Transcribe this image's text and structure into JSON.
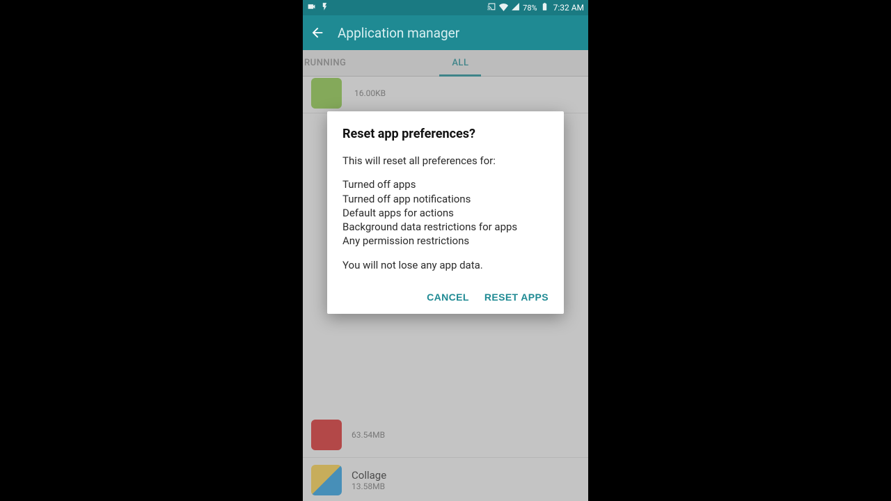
{
  "status": {
    "battery_pct": "78%",
    "time": "7:32 AM"
  },
  "appbar": {
    "title": "Application manager"
  },
  "tabs": {
    "running": "RUNNING",
    "all": "ALL"
  },
  "top_row": {
    "size": "16.00KB"
  },
  "apps": [
    {
      "name": "",
      "size": "63.54MB"
    },
    {
      "name": "Collage",
      "size": "13.58MB"
    }
  ],
  "dialog": {
    "title": "Reset app preferences?",
    "intro": "This will reset all preferences for:",
    "items": [
      "Turned off apps",
      "Turned off app notifications",
      "Default apps for actions",
      "Background data restrictions for apps",
      "Any permission restrictions"
    ],
    "footer": "You will not lose any app data.",
    "cancel": "CANCEL",
    "confirm": "RESET APPS"
  }
}
